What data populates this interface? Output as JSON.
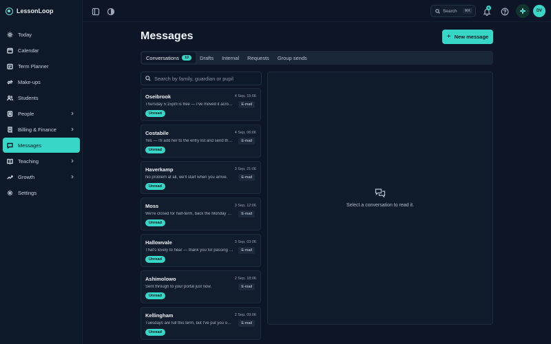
{
  "app": {
    "name": "LessonLoop"
  },
  "sidebar": {
    "items": [
      {
        "label": "Today",
        "icon": "sun-icon",
        "chevron": false,
        "active": false
      },
      {
        "label": "Calendar",
        "icon": "calendar-icon",
        "chevron": false,
        "active": false
      },
      {
        "label": "Term Planner",
        "icon": "term-planner-icon",
        "chevron": false,
        "active": false
      },
      {
        "label": "Make-ups",
        "icon": "repeat-icon",
        "chevron": false,
        "active": false
      },
      {
        "label": "Students",
        "icon": "users-icon",
        "chevron": false,
        "active": false
      },
      {
        "label": "People",
        "icon": "contacts-icon",
        "chevron": true,
        "active": false
      },
      {
        "label": "Billing & Finance",
        "icon": "receipt-icon",
        "chevron": true,
        "active": false
      },
      {
        "label": "Messages",
        "icon": "message-icon",
        "chevron": false,
        "active": true
      },
      {
        "label": "Teaching",
        "icon": "book-icon",
        "chevron": true,
        "active": false
      },
      {
        "label": "Growth",
        "icon": "growth-icon",
        "chevron": true,
        "active": false
      },
      {
        "label": "Settings",
        "icon": "gear-icon",
        "chevron": false,
        "active": false
      }
    ]
  },
  "topbar": {
    "search_label": "Search",
    "search_shortcut": "⌘K",
    "notifications_count": "6",
    "avatar_initials": "DV"
  },
  "main": {
    "title": "Messages",
    "new_button_label": "New message",
    "tabs": [
      {
        "label": "Conversations",
        "count": "10",
        "active": true
      },
      {
        "label": "Drafts",
        "active": false
      },
      {
        "label": "Internal",
        "active": false
      },
      {
        "label": "Requests",
        "active": false
      },
      {
        "label": "Group sends",
        "active": false
      }
    ],
    "search_placeholder": "Search by family, guardian or pupil",
    "conversations": [
      {
        "name": "Oseibrook",
        "date": "4 Sep, 15:06",
        "preview": "Thursday 5:15pm is free — I've moved it across for you.",
        "channel": "E-mail",
        "unread": "Unread"
      },
      {
        "name": "Costabile",
        "date": "4 Sep, 06:06",
        "preview": "Yes — I'll add her to the entry list and send the details.",
        "channel": "E-mail",
        "unread": "Unread"
      },
      {
        "name": "Haverkamp",
        "date": "3 Sep, 21:06",
        "preview": "No problem at all, we'll start when you arrive.",
        "channel": "E-mail",
        "unread": "Unread"
      },
      {
        "name": "Moss",
        "date": "3 Sep, 12:06",
        "preview": "We're closed for half-term, back the Monday after.",
        "channel": "E-mail",
        "unread": "Unread"
      },
      {
        "name": "Hallowvale",
        "date": "3 Sep, 03:06",
        "preview": "That's lovely to hear — thank you for passing it on.",
        "channel": "E-mail",
        "unread": "Unread"
      },
      {
        "name": "Ashimolowo",
        "date": "2 Sep, 18:06",
        "preview": "Sent through to your portal just now.",
        "channel": "E-mail",
        "unread": "Unread"
      },
      {
        "name": "Kellingham",
        "date": "2 Sep, 09:06",
        "preview": "Tuesdays are full this term, but I've put you on the list.",
        "channel": "E-mail",
        "unread": "Unread"
      }
    ],
    "empty_state": "Select a conversation to read it."
  },
  "colors": {
    "accent": "#38d6c7",
    "background": "#0c1626",
    "panel": "#101b2b"
  }
}
